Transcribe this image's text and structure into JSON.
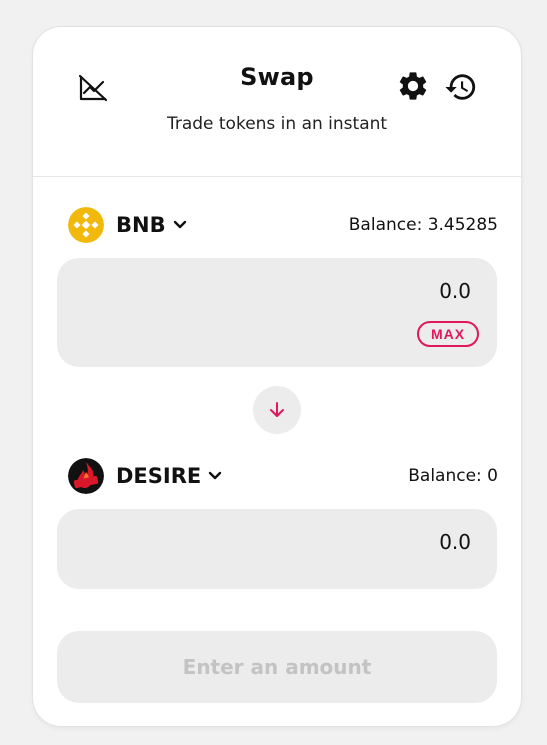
{
  "header": {
    "title": "Swap",
    "subtitle": "Trade tokens in an instant",
    "icons": [
      "chart-off-icon",
      "gear-icon",
      "history-icon"
    ]
  },
  "from": {
    "token": {
      "symbol": "BNB",
      "icon": "bnb-logo-icon",
      "color": "#F0B90B"
    },
    "balance": "Balance: 3.45285",
    "amount_placeholder": "0.0",
    "max_label": "MAX"
  },
  "to": {
    "token": {
      "symbol": "DESIRE",
      "icon": "desire-logo-icon"
    },
    "balance": "Balance: 0",
    "amount_placeholder": "0.0"
  },
  "switch": {
    "icon": "arrow-down-icon"
  },
  "submit": {
    "label": "Enter an amount",
    "disabled": true
  },
  "colors": {
    "accent": "#e0175a",
    "panel": "#ececec",
    "disabled_text": "#c3c3c3",
    "bnb": "#F0B90B"
  }
}
